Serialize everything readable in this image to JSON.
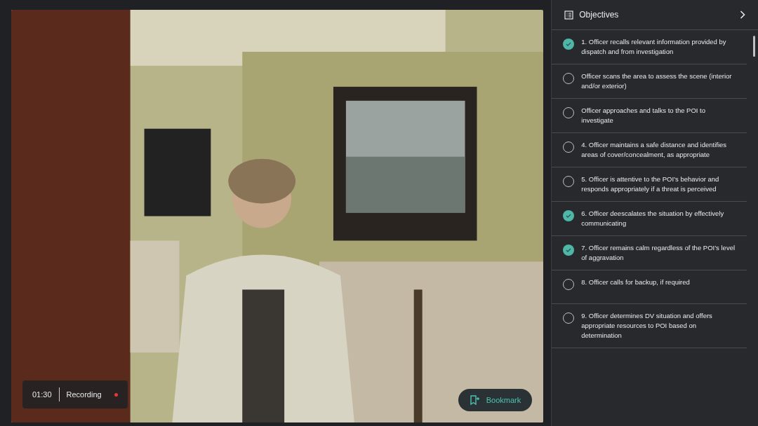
{
  "video": {
    "timer": "01:30",
    "status": "Recording",
    "recording": true,
    "bookmark": "Bookmark"
  },
  "objectives": {
    "title": "Objectives",
    "items": [
      {
        "text": "1. Officer recalls relevant information provided by dispatch and from investigation",
        "checked": true
      },
      {
        "text": "Officer scans the area to assess the scene (interior and/or exterior)",
        "checked": false
      },
      {
        "text": "Officer approaches and talks to the POI to investigate",
        "checked": false
      },
      {
        "text": "4. Officer maintains a safe distance and identifies areas of cover/concealment, as appropriate",
        "checked": false
      },
      {
        "text": "5. Officer is attentive to the POI’s behavior and responds appropriately if a threat is perceived",
        "checked": false
      },
      {
        "text": "6. Officer deescalates the situation by effectively communicating",
        "checked": true
      },
      {
        "text": "7. Officer remains calm regardless of the POI’s level of aggravation",
        "checked": true
      },
      {
        "text": "8. Officer calls for backup, if required",
        "checked": false
      },
      {
        "text": "9. Officer determines DV situation and offers appropriate resources to POI based on determination",
        "checked": false
      }
    ]
  }
}
